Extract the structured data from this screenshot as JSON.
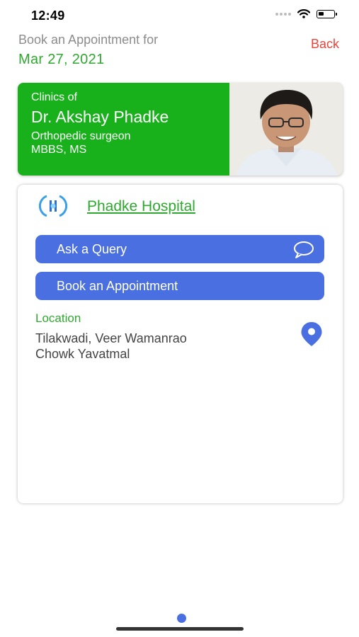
{
  "status_bar": {
    "time": "12:49",
    "icons": [
      "signal-dots-icon",
      "wifi-icon",
      "battery-icon"
    ]
  },
  "header": {
    "title": "Book an Appointment for",
    "date": "Mar 27, 2021",
    "back_label": "Back"
  },
  "doctor": {
    "clinics_label": "Clinics of",
    "name": "Dr. Akshay Phadke",
    "specialization": "Orthopedic surgeon",
    "degrees": "MBBS, MS"
  },
  "clinic": {
    "name": "Phadke Hospital",
    "ask_query_label": "Ask a Query",
    "book_appointment_label": "Book an Appointment",
    "location_title": "Location",
    "address_line1": "Tilakwadi, Veer Wamanrao",
    "address_line2": "Chowk Yavatmal"
  },
  "colors": {
    "accent_green": "#2fa82f",
    "card_green": "#18b11b",
    "button_blue": "#4a6fe0",
    "back_red": "#e8453c"
  }
}
